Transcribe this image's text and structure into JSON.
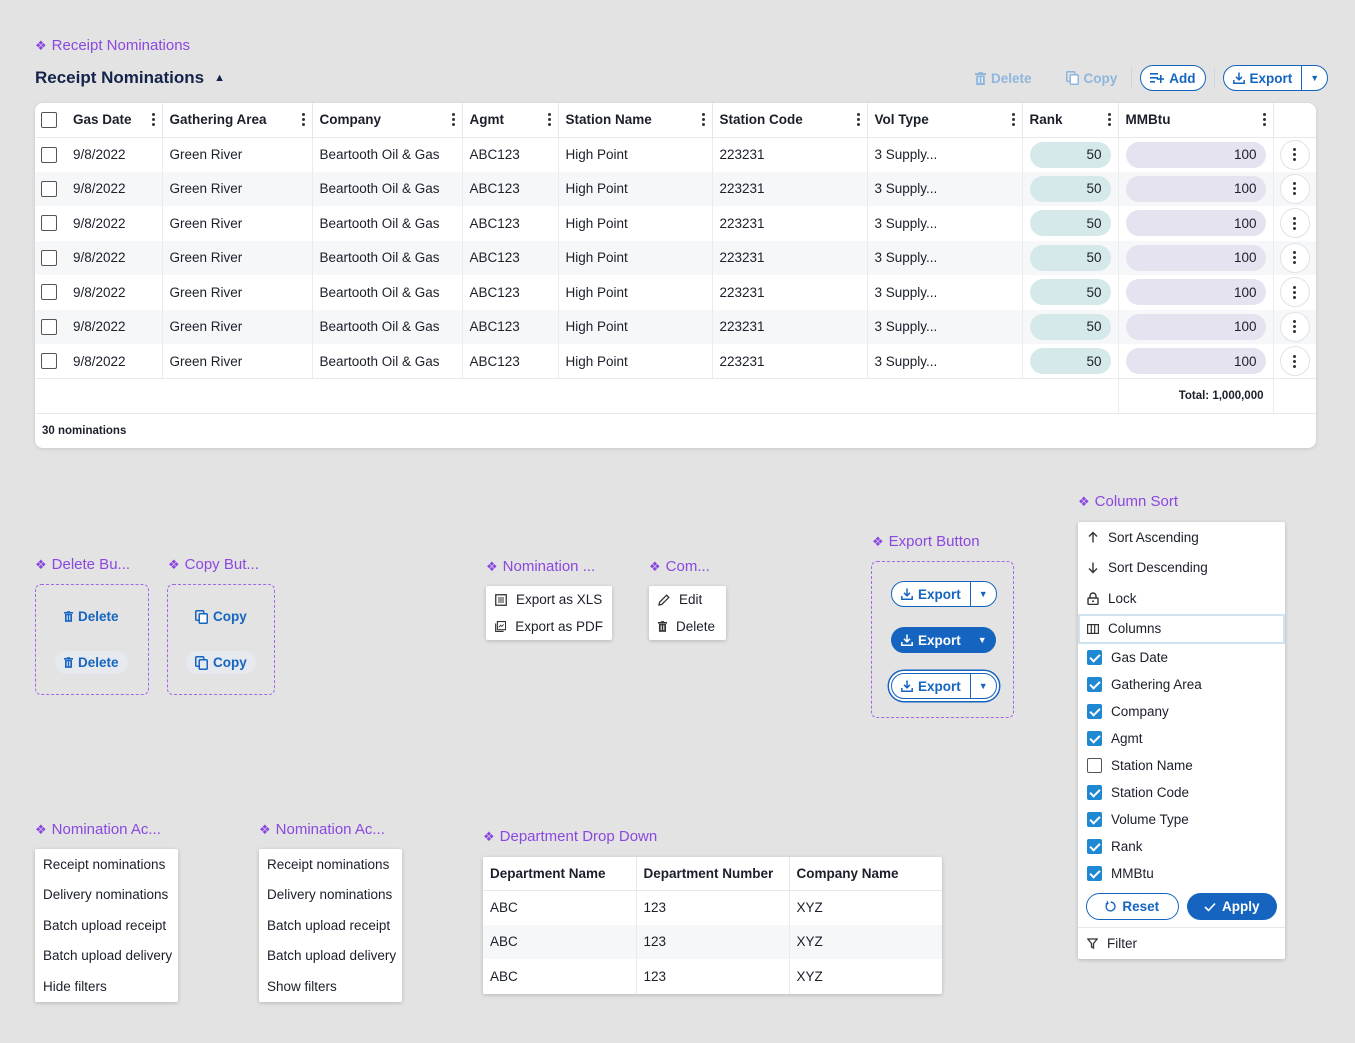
{
  "labels": {
    "receipt_nominations": "Receipt Nominations",
    "delete_button": "Delete Bu...",
    "copy_button": "Copy But...",
    "nomination_export": "Nomination ...",
    "com": "Com...",
    "export_button": "Export Button",
    "column_sort": "Column Sort",
    "nomination_ac_1": "Nomination Ac...",
    "nomination_ac_2": "Nomination Ac...",
    "department_drop_down": "Department Drop Down"
  },
  "header": {
    "title": "Receipt Nominations",
    "toolbar": {
      "delete": "Delete",
      "copy": "Copy",
      "add": "Add",
      "export": "Export"
    }
  },
  "table": {
    "columns": [
      "Gas Date",
      "Gathering Area",
      "Company",
      "Agmt",
      "Station Name",
      "Station Code",
      "Vol Type",
      "Rank",
      "MMBtu"
    ],
    "rows": [
      [
        "9/8/2022",
        "Green River",
        "Beartooth Oil & Gas",
        "ABC123",
        "High Point",
        "223231",
        "3 Supply...",
        "50",
        "100"
      ],
      [
        "9/8/2022",
        "Green River",
        "Beartooth Oil & Gas",
        "ABC123",
        "High Point",
        "223231",
        "3 Supply...",
        "50",
        "100"
      ],
      [
        "9/8/2022",
        "Green River",
        "Beartooth Oil & Gas",
        "ABC123",
        "High Point",
        "223231",
        "3 Supply...",
        "50",
        "100"
      ],
      [
        "9/8/2022",
        "Green River",
        "Beartooth Oil & Gas",
        "ABC123",
        "High Point",
        "223231",
        "3 Supply...",
        "50",
        "100"
      ],
      [
        "9/8/2022",
        "Green River",
        "Beartooth Oil & Gas",
        "ABC123",
        "High Point",
        "223231",
        "3 Supply...",
        "50",
        "100"
      ],
      [
        "9/8/2022",
        "Green River",
        "Beartooth Oil & Gas",
        "ABC123",
        "High Point",
        "223231",
        "3 Supply...",
        "50",
        "100"
      ],
      [
        "9/8/2022",
        "Green River",
        "Beartooth Oil & Gas",
        "ABC123",
        "High Point",
        "223231",
        "3 Supply...",
        "50",
        "100"
      ]
    ],
    "total": "Total: 1,000,000",
    "count": "30 nominations"
  },
  "delete_demo": {
    "label": "Delete"
  },
  "copy_demo": {
    "label": "Copy"
  },
  "export_menu": {
    "items": [
      "Export as XLS",
      "Export as PDF"
    ]
  },
  "row_menu": {
    "items": [
      "Edit",
      "Delete"
    ]
  },
  "export_demo": {
    "label": "Export"
  },
  "column_sort": {
    "sort_ascending": "Sort Ascending",
    "sort_descending": "Sort Descending",
    "lock": "Lock",
    "columns": "Columns",
    "items": [
      {
        "label": "Gas Date",
        "checked": true
      },
      {
        "label": "Gathering Area",
        "checked": true
      },
      {
        "label": "Company",
        "checked": true
      },
      {
        "label": "Agmt",
        "checked": true
      },
      {
        "label": "Station Name",
        "checked": false
      },
      {
        "label": "Station Code",
        "checked": true
      },
      {
        "label": "Volume Type",
        "checked": true
      },
      {
        "label": "Rank",
        "checked": true
      },
      {
        "label": "MMBtu",
        "checked": true
      }
    ],
    "reset": "Reset",
    "apply": "Apply",
    "filter": "Filter"
  },
  "action_menu_1": {
    "items": [
      "Receipt nominations",
      "Delivery nominations",
      "Batch upload receipt",
      "Batch upload delivery",
      "Hide filters"
    ]
  },
  "action_menu_2": {
    "items": [
      "Receipt nominations",
      "Delivery nominations",
      "Batch upload receipt",
      "Batch upload delivery",
      "Show filters"
    ]
  },
  "department": {
    "columns": [
      "Department Name",
      "Department Number",
      "Company Name"
    ],
    "rows": [
      [
        "ABC",
        "123",
        "XYZ"
      ],
      [
        "ABC",
        "123",
        "XYZ"
      ],
      [
        "ABC",
        "123",
        "XYZ"
      ]
    ]
  },
  "colors": {
    "accent": "#1565c0",
    "label": "#8b48e0",
    "rank_fill": "#d6e9ea",
    "mmbtu_fill": "#e4e3ef",
    "check": "#1e88d2"
  }
}
